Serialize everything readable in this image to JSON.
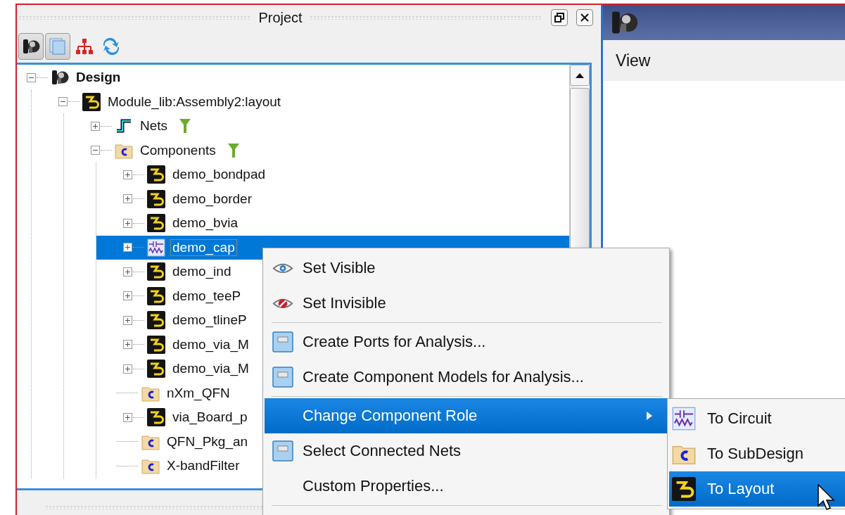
{
  "project_panel": {
    "title": "Project",
    "toolbar": [
      {
        "kind": "design",
        "pressed": true
      },
      {
        "kind": "pages",
        "pressed": true
      },
      {
        "kind": "hierarchy",
        "pressed": false
      },
      {
        "kind": "sync",
        "pressed": false
      }
    ],
    "tree": [
      {
        "label": "Design",
        "kind": "design",
        "expanded": true,
        "selected": false,
        "children": [
          {
            "label": "Module_lib:Assembly2:layout",
            "kind": "layout",
            "expanded": true,
            "selected": false,
            "children": [
              {
                "label": "Nets",
                "kind": "nets",
                "expanded": false,
                "filter": true,
                "selected": false
              },
              {
                "label": "Components",
                "kind": "folder",
                "expanded": true,
                "filter": true,
                "selected": false,
                "children": [
                  {
                    "label": "demo_bondpad",
                    "kind": "layout",
                    "expanded": false,
                    "selected": false
                  },
                  {
                    "label": "demo_border",
                    "kind": "layout",
                    "expanded": false,
                    "selected": false
                  },
                  {
                    "label": "demo_bvia",
                    "kind": "layout",
                    "expanded": false,
                    "selected": false
                  },
                  {
                    "label": "demo_cap",
                    "kind": "circuit",
                    "expanded": false,
                    "selected": true
                  },
                  {
                    "label": "demo_ind",
                    "kind": "layout",
                    "expanded": false,
                    "selected": false
                  },
                  {
                    "label": "demo_teeP",
                    "kind": "layout",
                    "expanded": false,
                    "selected": false
                  },
                  {
                    "label": "demo_tlineP",
                    "kind": "layout",
                    "expanded": false,
                    "selected": false
                  },
                  {
                    "label": "demo_via_M",
                    "kind": "layout",
                    "expanded": false,
                    "selected": false
                  },
                  {
                    "label": "demo_via_M",
                    "kind": "layout",
                    "expanded": false,
                    "selected": false
                  },
                  {
                    "label": "nXm_QFN",
                    "kind": "folder",
                    "selected": false
                  },
                  {
                    "label": "via_Board_p",
                    "kind": "layout",
                    "expanded": false,
                    "selected": false
                  },
                  {
                    "label": "QFN_Pkg_an",
                    "kind": "folder",
                    "selected": false
                  },
                  {
                    "label": "X-bandFilter",
                    "kind": "folder",
                    "selected": false
                  }
                ]
              }
            ]
          }
        ]
      }
    ]
  },
  "context_menu": {
    "items": [
      {
        "kind": "show",
        "label": "Set Visible",
        "selected": false
      },
      {
        "kind": "hide",
        "label": "Set Invisible",
        "selected": false
      },
      {
        "kind": "separator"
      },
      {
        "kind": "action",
        "label": "Create Ports for Analysis...",
        "selected": false
      },
      {
        "kind": "action",
        "label": "Create Component Models for Analysis...",
        "selected": false
      },
      {
        "kind": "separator"
      },
      {
        "kind": "submenu",
        "label": "Change Component Role",
        "selected": true
      },
      {
        "kind": "action",
        "label": "Select Connected Nets",
        "selected": false
      },
      {
        "kind": "plain",
        "label": "Custom Properties...",
        "selected": false
      },
      {
        "kind": "separator"
      }
    ]
  },
  "submenu": {
    "items": [
      {
        "kind": "circuit",
        "label": "To Circuit",
        "selected": false
      },
      {
        "kind": "folder",
        "label": "To SubDesign",
        "selected": false
      },
      {
        "kind": "layout",
        "label": "To Layout",
        "selected": true
      }
    ]
  },
  "side_window": {
    "menu": [
      {
        "label": "View"
      }
    ]
  }
}
